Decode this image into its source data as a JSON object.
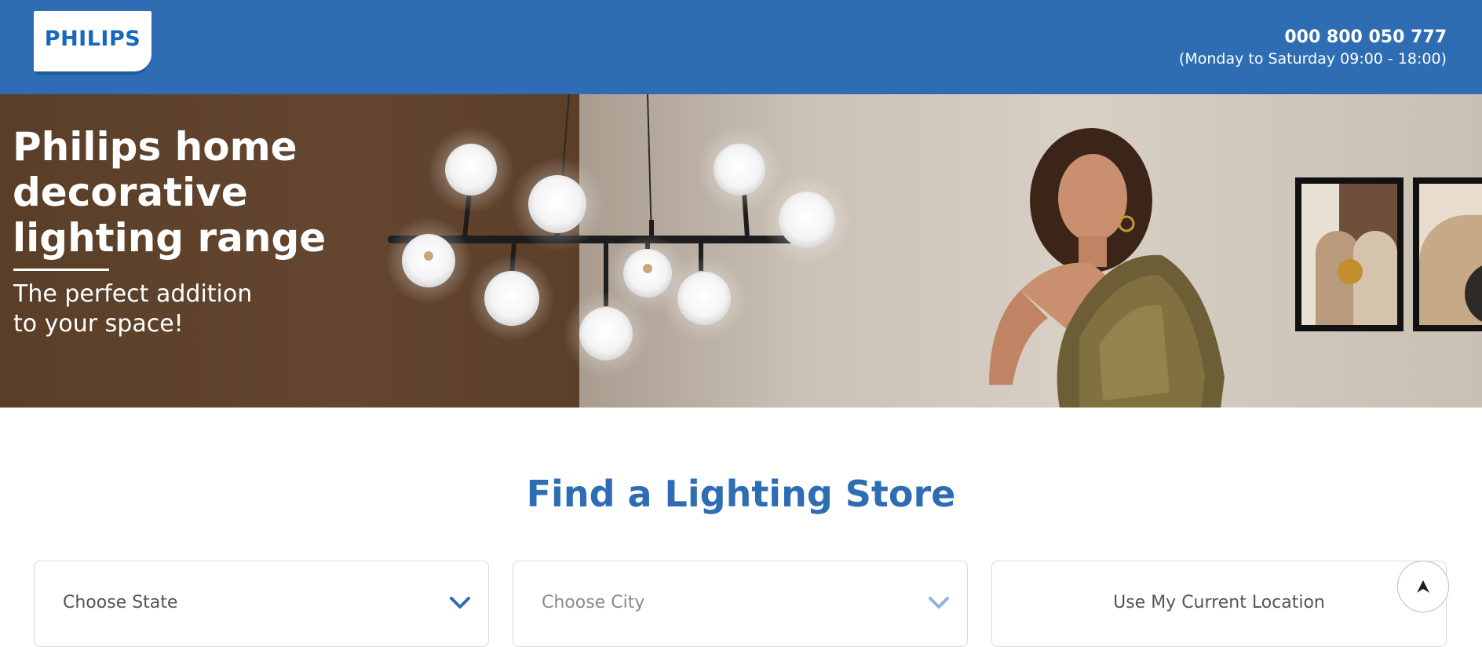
{
  "header": {
    "logo_text": "PHILIPS",
    "phone": "000 800 050 777",
    "hours": "(Monday to Saturday 09:00 - 18:00)",
    "brand_color": "#2e6db4"
  },
  "hero": {
    "title": "Philips home decorative lighting range",
    "subtitle": "The perfect addition to your space!"
  },
  "finder": {
    "title": "Find a Lighting Store",
    "state_placeholder": "Choose State",
    "city_placeholder": "Choose City",
    "location_button": "Use My Current Location",
    "accent_color": "#2e6db4"
  },
  "icons": {
    "dropdown": "chevron-down-icon",
    "scroll_top": "arrow-up-icon"
  }
}
